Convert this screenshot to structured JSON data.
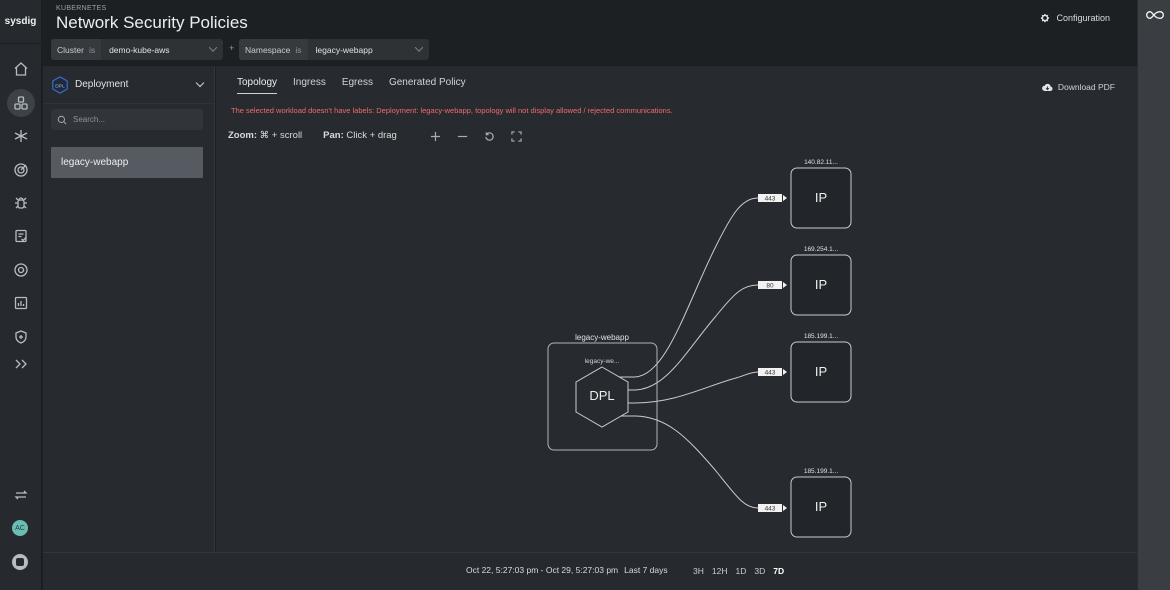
{
  "app": {
    "logo": "sysdig",
    "eyebrow": "KUBERNETES",
    "title": "Network Security Policies",
    "config_label": "Configuration"
  },
  "nav": {
    "items": [
      {
        "icon": "home-icon"
      },
      {
        "icon": "topology-icon",
        "active": true
      },
      {
        "icon": "integrations-icon"
      },
      {
        "icon": "posture-icon"
      },
      {
        "icon": "vulnerabilities-icon"
      },
      {
        "icon": "policies-icon"
      },
      {
        "icon": "threat-icon"
      },
      {
        "icon": "reports-icon"
      },
      {
        "icon": "shield-plus-icon"
      },
      {
        "icon": "expand-icon"
      }
    ],
    "avatar_initials": "AC",
    "avatar_color": "#6bbcb3"
  },
  "filters": [
    {
      "key": "Cluster",
      "op": "is",
      "value": "demo-kube-aws"
    },
    {
      "key": "Namespace",
      "op": "is",
      "value": "legacy-webapp"
    }
  ],
  "filter_join": "+",
  "left_panel": {
    "type_badge": "DPL",
    "type_label": "Deployment",
    "search_placeholder": "Search...",
    "items": [
      {
        "label": "legacy-webapp",
        "selected": true
      }
    ]
  },
  "main": {
    "tabs": [
      {
        "label": "Topology",
        "active": true
      },
      {
        "label": "Ingress"
      },
      {
        "label": "Egress"
      },
      {
        "label": "Generated Policy"
      }
    ],
    "download_label": "Download PDF",
    "warning": "The selected workload doesn't have labels: Deployment: legacy-webapp, topology will not display allowed / rejected communications.",
    "warning_color": "#ef6b6b",
    "zoom_label": "Zoom:",
    "zoom_hint": "⌘ + scroll",
    "pan_label": "Pan:",
    "pan_hint": "Click + drag"
  },
  "topology": {
    "source": {
      "group_label": "legacy-webapp",
      "node_label": "legacy-we...",
      "badge": "DPL"
    },
    "targets": [
      {
        "label": "140.82.11...",
        "type": "IP",
        "port": "443"
      },
      {
        "label": "169.254.1...",
        "type": "IP",
        "port": "80"
      },
      {
        "label": "185.199.1...",
        "type": "IP",
        "port": "443"
      },
      {
        "label": "185.199.1...",
        "type": "IP",
        "port": "443"
      }
    ]
  },
  "footer": {
    "range": "Oct 22, 5:27:03 pm - Oct 29, 5:27:03 pm",
    "range_label": "Last 7 days",
    "presets": [
      "3H",
      "12H",
      "1D",
      "3D",
      "7D"
    ],
    "selected_preset": "7D"
  }
}
